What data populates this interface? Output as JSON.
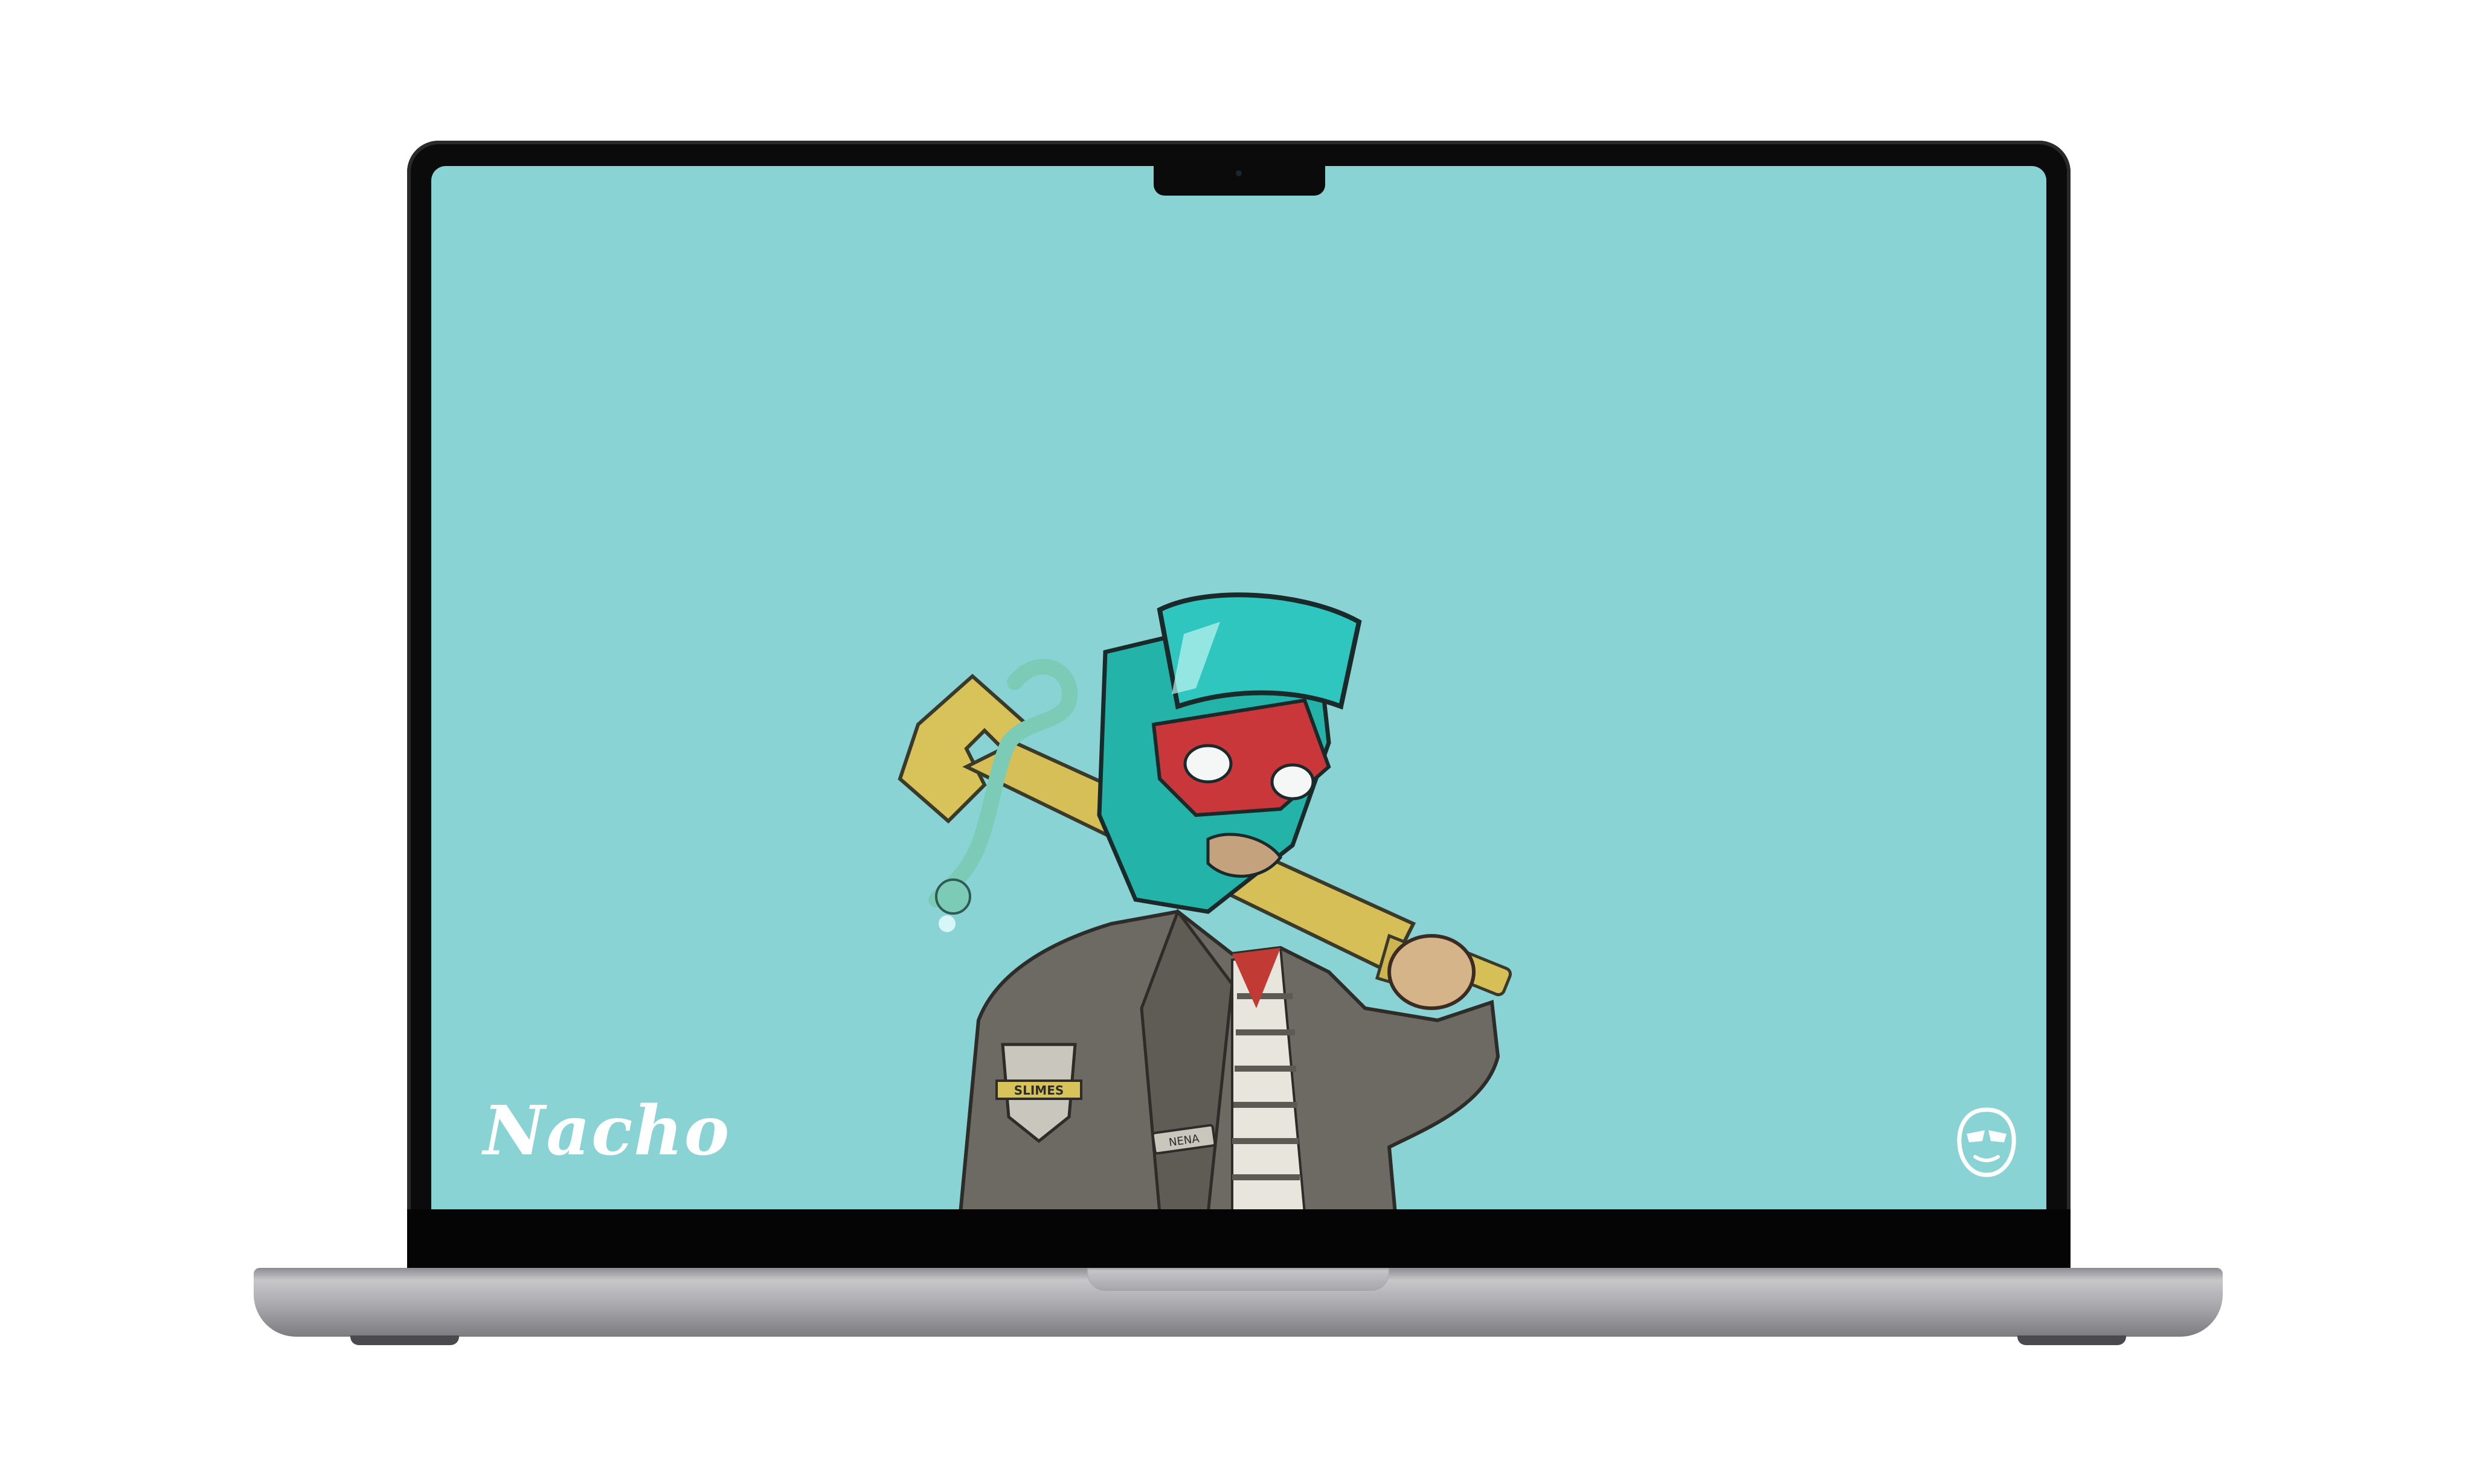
{
  "wallpaper": {
    "background_color": "#8ad3d5",
    "wordmark": "Nacho",
    "illustration": "luchador-character-with-wrench-icon",
    "badge_text": "SLIMES",
    "name_tag": "NENA",
    "corner_logo": "luchador-mask-icon"
  },
  "device": {
    "type": "laptop",
    "frame_color": "#0b0b0c",
    "body_color": "#a9a9ad"
  }
}
